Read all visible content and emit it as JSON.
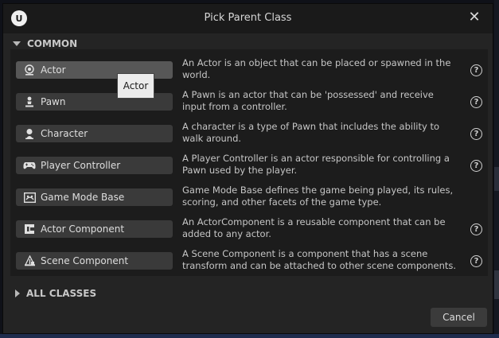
{
  "dialog": {
    "title": "Pick Parent Class",
    "logo_text": "U",
    "close_glyph": "✕"
  },
  "sections": {
    "common": "COMMON",
    "all_classes": "ALL CLASSES"
  },
  "classes": [
    {
      "label": "Actor",
      "icon": "actor-icon",
      "description": "An Actor is an object that can be placed or spawned in the world.",
      "help": true
    },
    {
      "label": "Pawn",
      "icon": "pawn-icon",
      "description": "A Pawn is an actor that can be 'possessed' and receive input from a controller.",
      "help": true
    },
    {
      "label": "Character",
      "icon": "character-icon",
      "description": "A character is a type of Pawn that includes the ability to walk around.",
      "help": true
    },
    {
      "label": "Player Controller",
      "icon": "gamepad-icon",
      "description": "A Player Controller is an actor responsible for controlling a Pawn used by the player.",
      "help": true
    },
    {
      "label": "Game Mode Base",
      "icon": "game-mode-icon",
      "description": "Game Mode Base defines the game being played, its rules, scoring, and other facets of the game type.",
      "help": false
    },
    {
      "label": "Actor Component",
      "icon": "actor-component-icon",
      "description": "An ActorComponent is a reusable component that can be added to any actor.",
      "help": true
    },
    {
      "label": "Scene Component",
      "icon": "scene-component-icon",
      "description": "A Scene Component is a component that has a scene transform and can be attached to other scene components.",
      "help": true
    }
  ],
  "help_glyph": "?",
  "tooltip": "Actor",
  "cancel_label": "Cancel"
}
